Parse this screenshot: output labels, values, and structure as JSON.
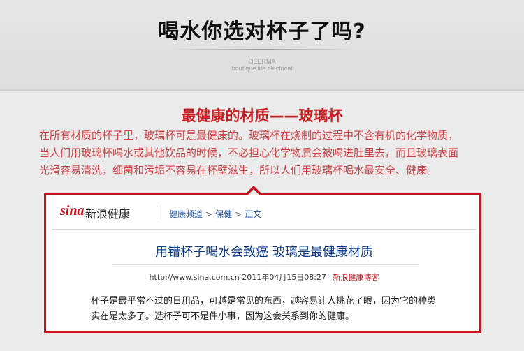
{
  "banner": {
    "headline": "喝水你选对杯子了吗?",
    "brand_name": "OEERMA",
    "brand_tagline": "boutique life electrical"
  },
  "section": {
    "title": "最健康的材质——玻璃杯",
    "text_lines": [
      "在所有材质的杯子里，玻璃杯可是最健康的。玻璃杯在烧制的过程中不含有机的化学物质，",
      "当人们用玻璃杯喝水或其他饮品的时候，不必担心化学物质会被喝进肚里去，而且玻璃表面",
      "光滑容易清洗，细菌和污垢不容易在杯壁滋生，所以人们用玻璃杯喝水最安全、健康。"
    ]
  },
  "sina": {
    "logo": "sina",
    "section_name": "新浪健康",
    "breadcrumb": [
      "健康频道",
      "保健",
      "正文"
    ],
    "breadcrumb_separator": ">"
  },
  "article": {
    "title": "用错杯子喝水会致癌  玻璃是最健康材质",
    "url": "http://www.sina.com.cn",
    "date": "2011年04月15日08:27",
    "source": "新浪健康博客",
    "body_lines": [
      "杯子是最平常不过的日用品，可越是常见的东西，越容易让人挑花了眼，因为它的种类",
      "实在是太多了。选杯子可不是件小事，因为这会关系到你的健康。"
    ]
  },
  "colors": {
    "accent_red": "#c81f24",
    "link_blue": "#1f4f9a"
  }
}
